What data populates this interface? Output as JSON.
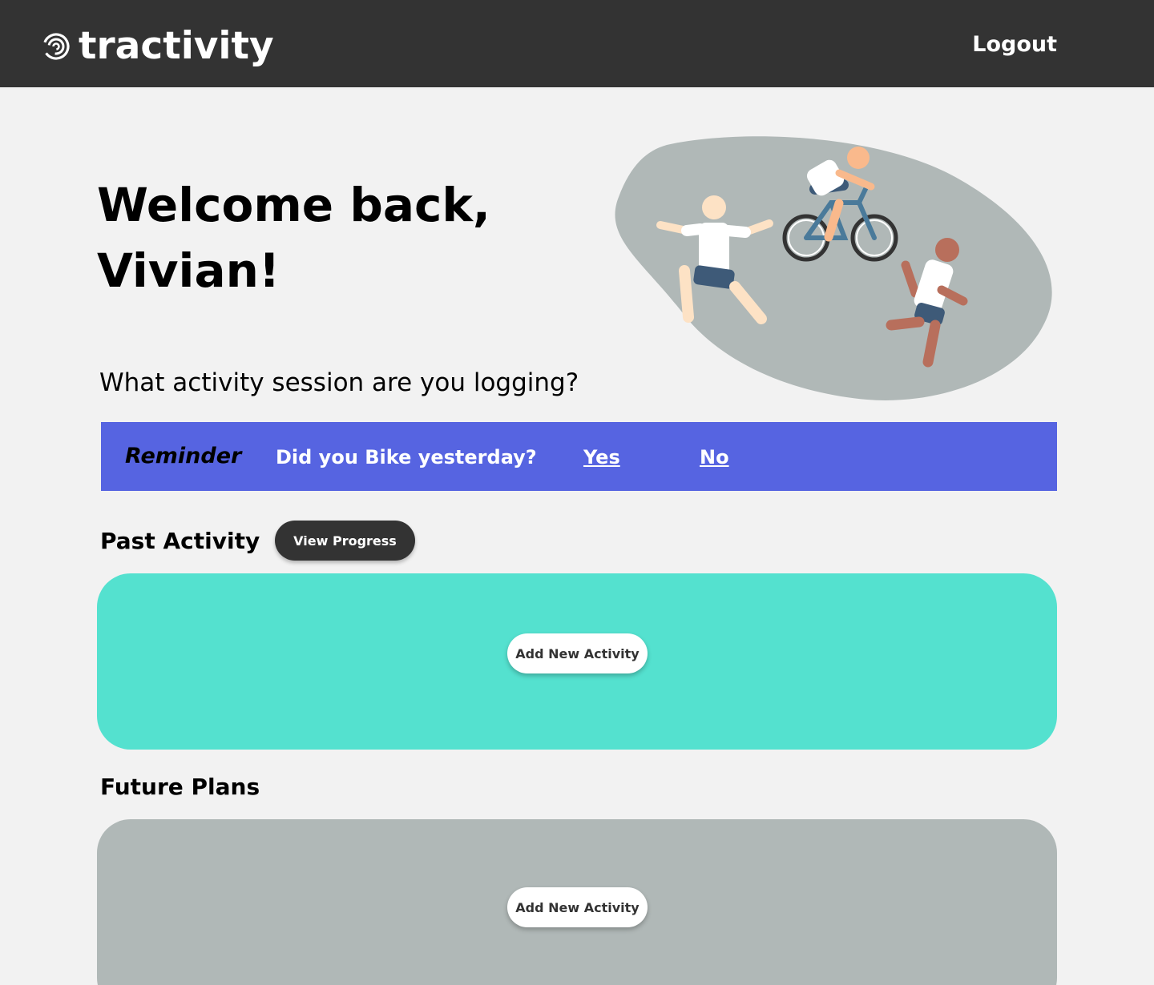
{
  "header": {
    "brand_name": "tractivity",
    "logout_label": "Logout"
  },
  "hero": {
    "welcome_line1": "Welcome back,",
    "welcome_line2": "Vivian!",
    "question": "What activity session are you logging?"
  },
  "reminder": {
    "tag": "Reminder",
    "message": "Did you Bike yesterday?",
    "yes_label": "Yes",
    "no_label": "No"
  },
  "past_activity": {
    "title": "Past Activity",
    "view_progress_label": "View Progress",
    "add_label": "Add New Activity"
  },
  "future_plans": {
    "title": "Future Plans",
    "add_label": "Add New Activity"
  },
  "colors": {
    "topbar": "#333333",
    "background": "#f2f2f2",
    "reminder": "#5664e1",
    "past_panel": "#54e1cf",
    "future_panel": "#b0b8b7",
    "illustration_blob": "#b0b8b7"
  },
  "icons": {
    "brand": "spiral-logo-icon",
    "illustration": "athletes-illustration"
  }
}
